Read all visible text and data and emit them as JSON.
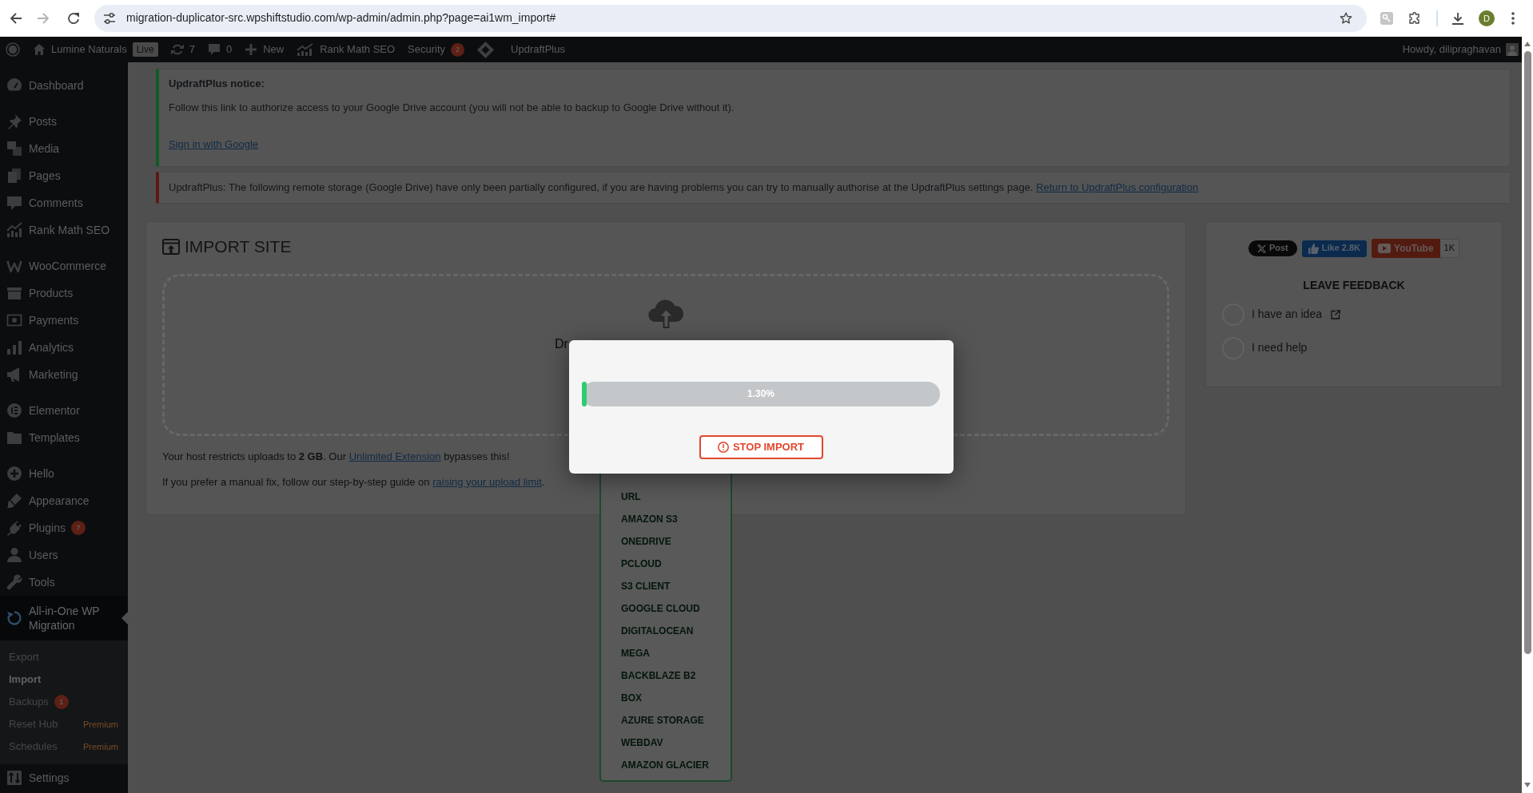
{
  "browser": {
    "url": "migration-duplicator-src.wpshiftstudio.com/wp-admin/admin.php?page=ai1wm_import#",
    "profile_initial": "D"
  },
  "admin_bar": {
    "items": [
      {
        "kind": "site",
        "label": "Lumine Naturals",
        "badge": "Live"
      },
      {
        "kind": "updates",
        "label": "7"
      },
      {
        "kind": "comments",
        "label": "0"
      },
      {
        "kind": "new",
        "label": "New"
      },
      {
        "kind": "seo",
        "label": "Rank Math SEO"
      },
      {
        "kind": "security",
        "label": "Security",
        "count": "2"
      },
      {
        "kind": "backup",
        "label": "UpdraftPlus"
      }
    ],
    "account": "Howdy, dilipraghavan"
  },
  "sidebar": {
    "groups": [
      {
        "items": [
          {
            "label": "Dashboard",
            "selected": false
          }
        ]
      },
      {
        "items": [
          {
            "label": "Posts",
            "selected": false
          },
          {
            "label": "Media",
            "selected": false
          },
          {
            "label": "Pages",
            "selected": false
          },
          {
            "label": "Comments",
            "selected": false
          },
          {
            "label": "Rank Math SEO",
            "selected": false
          }
        ]
      },
      {
        "items": [
          {
            "label": "WooCommerce",
            "selected": false
          },
          {
            "label": "Products",
            "selected": false
          },
          {
            "label": "Payments",
            "selected": false
          },
          {
            "label": "Analytics",
            "selected": false
          },
          {
            "label": "Marketing",
            "selected": false
          }
        ]
      },
      {
        "items": [
          {
            "label": "Elementor",
            "selected": false
          },
          {
            "label": "Templates",
            "selected": false
          }
        ]
      },
      {
        "items": [
          {
            "label": "Hello",
            "selected": false
          },
          {
            "label": "Appearance",
            "selected": false
          },
          {
            "label": "Plugins",
            "badge": "7",
            "selected": false
          },
          {
            "label": "Users",
            "selected": false
          },
          {
            "label": "Tools",
            "selected": false
          },
          {
            "label": "All-in-One WP Migration",
            "selected": true,
            "children": [
              {
                "label": "Export",
                "selected": false
              },
              {
                "label": "Import",
                "selected": true
              },
              {
                "label": "Backups",
                "badge": "1",
                "selected": false
              },
              {
                "label": "Reset Hub",
                "tag": "Premium",
                "selected": false
              },
              {
                "label": "Schedules",
                "tag": "Premium",
                "selected": false
              }
            ]
          },
          {
            "label": "Settings",
            "selected": false
          }
        ]
      }
    ]
  },
  "notices": [
    {
      "kind": "success",
      "title": "UpdraftPlus notice:",
      "text": "Follow this link to authorize access to your Google Drive account (you will not be able to backup to Google Drive without it).",
      "link": "Sign in with Google"
    },
    {
      "kind": "error",
      "text": "UpdraftPlus: The following remote storage (Google Drive) have only been partially configured, if you are having problems you can try to manually authorise at the UpdraftPlus settings page.",
      "link": "Return to UpdraftPlus configuration"
    }
  ],
  "import_panel": {
    "title": "IMPORT SITE",
    "drop_zone_text": "Dr",
    "notes": [
      {
        "before": "Your host restricts uploads to **2 GB**. Our ",
        "link": "Unlimited Extension",
        "after": " bypasses this!"
      },
      {
        "before": "If you prefer a manual fix, follow our step-by-step guide on ",
        "link": "raising your upload limit",
        "after": "."
      }
    ]
  },
  "import_menu": {
    "items": [
      "URL",
      "AMAZON S3",
      "ONEDRIVE",
      "PCLOUD",
      "S3 CLIENT",
      "GOOGLE CLOUD",
      "DIGITALOCEAN",
      "MEGA",
      "BACKBLAZE B2",
      "BOX",
      "AZURE STORAGE",
      "WEBDAV",
      "AMAZON GLACIER"
    ]
  },
  "progress_dialog": {
    "level": 0.013,
    "reading": "1.30%",
    "button": "STOP IMPORT"
  },
  "feedback_panel": {
    "social": [
      {
        "kind": "post",
        "label": "Post"
      },
      {
        "kind": "like",
        "label": "Like 2.8K"
      },
      {
        "kind": "channel",
        "label": "YouTube",
        "count": "1K"
      }
    ],
    "title": "LEAVE FEEDBACK",
    "options": [
      {
        "label": "I have an idea",
        "external": true,
        "selected": false
      },
      {
        "label": "I need help",
        "external": false,
        "selected": false
      }
    ]
  }
}
